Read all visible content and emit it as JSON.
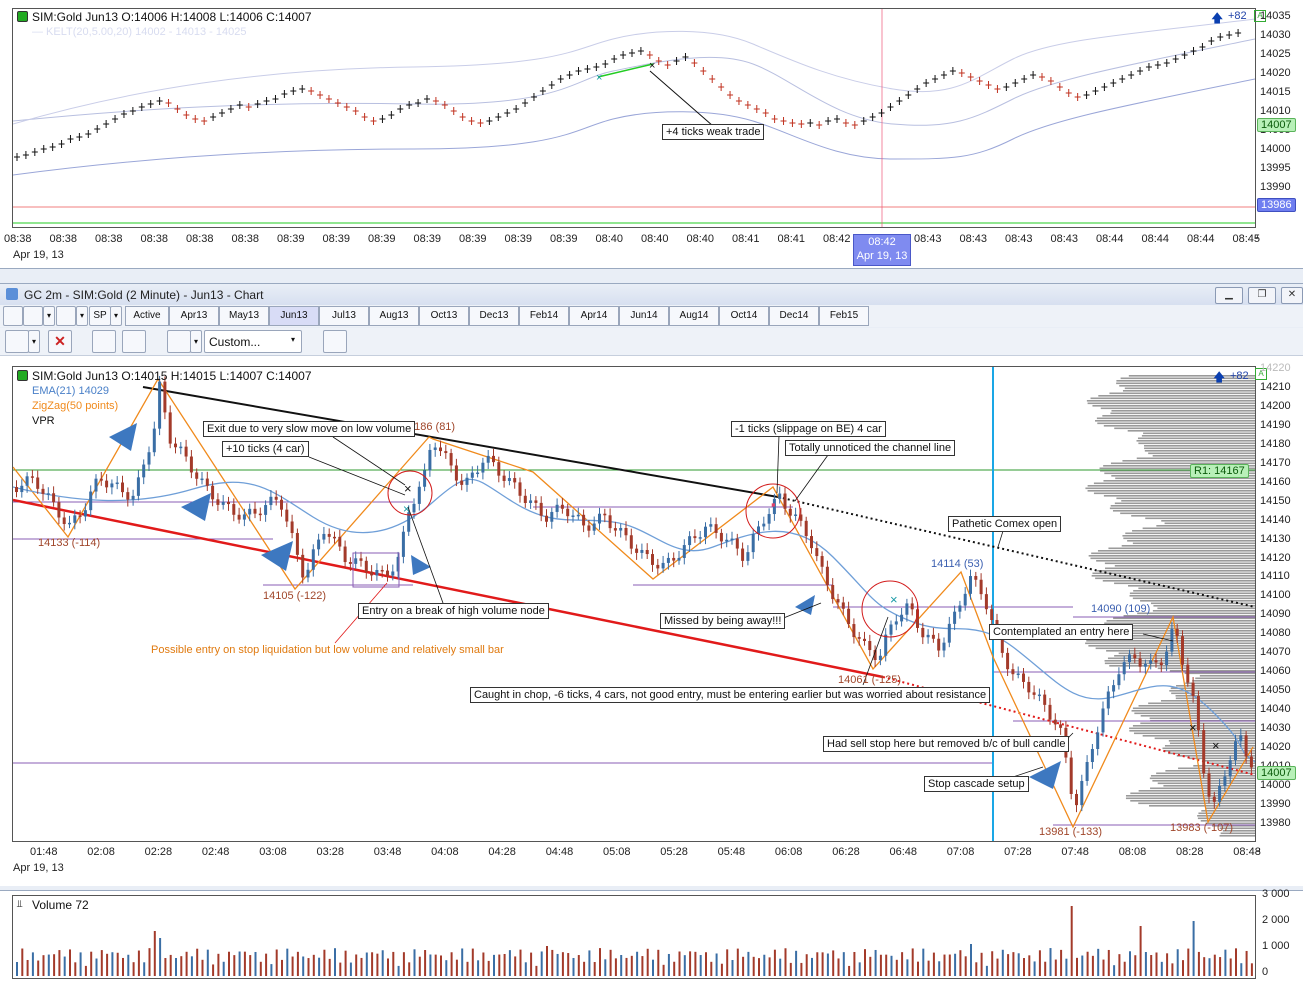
{
  "top_chart": {
    "header": "SIM:Gold Jun13 O:14006 H:14008 L:14006 C:14007",
    "kelt_label": "— KELT(20,5.00,20) 14002 - 14013 - 14025",
    "price_ticks": [
      "14035",
      "14030",
      "14025",
      "14020",
      "14015",
      "14010",
      "14005",
      "14000",
      "13995",
      "13990",
      "13985"
    ],
    "time_ticks": [
      "08:38",
      "08:38",
      "08:38",
      "08:38",
      "08:38",
      "08:38",
      "08:39",
      "08:39",
      "08:39",
      "08:39",
      "08:39",
      "08:39",
      "08:39",
      "08:40",
      "08:40",
      "08:40",
      "08:41",
      "08:41",
      "08:42",
      "08:42",
      "08:43",
      "08:43",
      "08:43",
      "08:43",
      "08:44",
      "08:44",
      "08:44",
      "08:45"
    ],
    "date": "Apr 19, 13",
    "cursor_time": "08:42",
    "cursor_date": "Apr 19, 13",
    "current_price": "14007",
    "low_price_tag": "13986",
    "plus_ticks": "+82",
    "annotation": "+4 ticks weak trade"
  },
  "window": {
    "title": "GC 2m - SIM:Gold (2 Minute) - Jun13 - Chart",
    "buttons": [
      "minimize",
      "restore",
      "close"
    ]
  },
  "toolbar": {
    "sp_label": "SP",
    "tabs": [
      "Active",
      "Apr13",
      "May13",
      "Jun13",
      "Jul13",
      "Aug13",
      "Oct13",
      "Dec13",
      "Feb14",
      "Apr14",
      "Jun14",
      "Aug14",
      "Oct14",
      "Dec14",
      "Feb15"
    ],
    "active_tab": "Jun13",
    "custom_label": "Custom..."
  },
  "main_chart": {
    "header": "SIM:Gold Jun13 O:14015 H:14015 L:14007 C:14007",
    "ema_label": "EMA(21) 14029",
    "zigzag_label": "ZigZag(50 points)",
    "vpr_label": "VPR",
    "plus_ticks": "+82",
    "price_ticks": [
      "14220",
      "14210",
      "14200",
      "14190",
      "14180",
      "14170",
      "14160",
      "14150",
      "14140",
      "14130",
      "14120",
      "14110",
      "14100",
      "14090",
      "14080",
      "14070",
      "14060",
      "14050",
      "14040",
      "14030",
      "14020",
      "14010",
      "14000",
      "13990",
      "13980"
    ],
    "time_ticks": [
      "01:48",
      "02:08",
      "02:28",
      "02:48",
      "03:08",
      "03:28",
      "03:48",
      "04:08",
      "04:28",
      "04:48",
      "05:08",
      "05:28",
      "05:48",
      "06:08",
      "06:28",
      "06:48",
      "07:08",
      "07:28",
      "07:48",
      "08:08",
      "08:28",
      "08:48"
    ],
    "date": "Apr 19, 13",
    "r1_label": "R1: 14167",
    "current_price": "14007",
    "zigzag_labels": [
      "14133 (-114)",
      "14105 (-122)",
      "4186 (81)",
      "14061 (-125)",
      "14114 (53)",
      "14090 (109)",
      "13981 (-133)",
      "13983 (-107)"
    ],
    "callouts": [
      "Exit due to very slow move on low volume",
      "+10 ticks (4 car)",
      "Entry on a break of high volume node",
      "-1 ticks (slippage on BE) 4 car",
      "Totally unnoticed the channel line",
      "Pathetic Comex open",
      "Missed by being away!!!",
      "Contemplated an entry here",
      "Caught in chop, -6 ticks, 4 cars, not good entry, must be entering earlier but was worried about resistance",
      "Had sell stop here but removed b/c of bull candle",
      "Stop cascade setup"
    ],
    "orange_note": "Possible entry on stop liquidation but low volume and relatively small bar"
  },
  "volume_chart": {
    "label": "Volume 72",
    "ticks": [
      "3 000",
      "2 000",
      "1 000",
      "0"
    ]
  },
  "colors": {
    "bull": "#3a6ea5",
    "bear": "#a33a2a",
    "ema": "#6f9fd8",
    "zigzag": "#f08a1c",
    "trend_red": "#e11a1a",
    "r1_line": "#2c9a2c",
    "vpr": "#888888"
  }
}
